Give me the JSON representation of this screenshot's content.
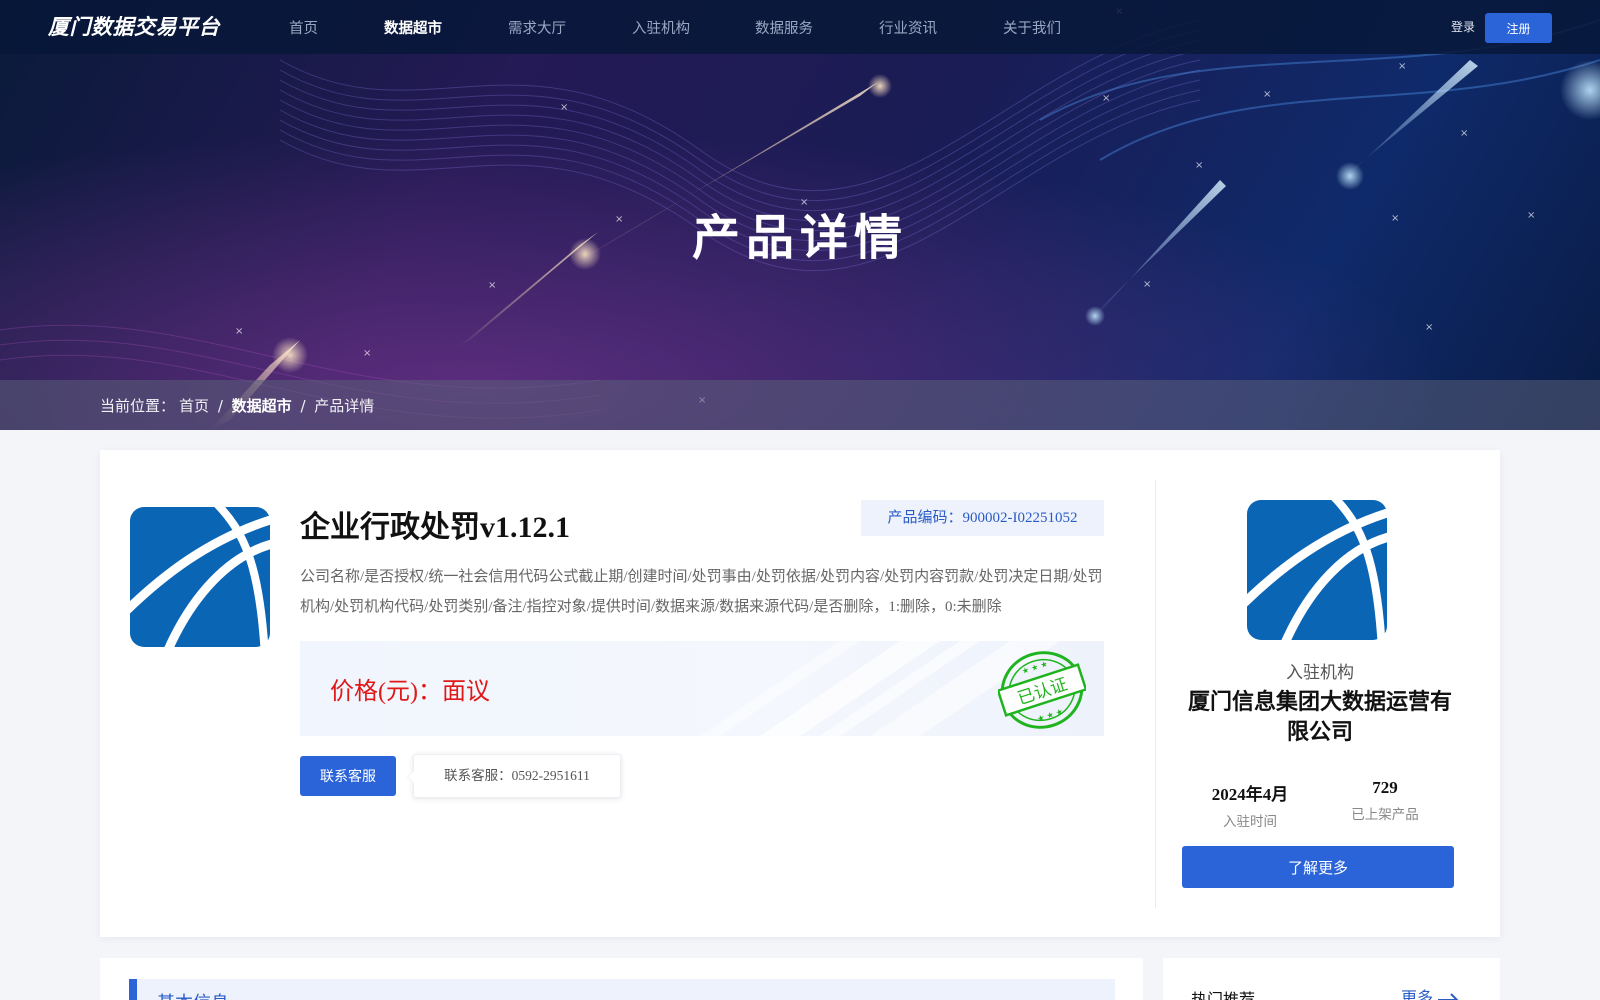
{
  "brand": {
    "name": "厦门数据交易平台"
  },
  "nav": {
    "items": [
      "首页",
      "数据超市",
      "需求大厅",
      "入驻机构",
      "数据服务",
      "行业资讯",
      "关于我们"
    ],
    "active_index": 1
  },
  "auth": {
    "login": "登录",
    "register": "注册"
  },
  "hero": {
    "title": "产品详情"
  },
  "breadcrumb": {
    "prefix": "当前位置：",
    "items": [
      "首页",
      "数据超市",
      "产品详情"
    ],
    "separator": "/"
  },
  "product": {
    "title": "企业行政处罚v1.12.1",
    "code_label": "产品编码：",
    "code": "900002-I02251052",
    "description": "公司名称/是否授权/统一社会信用代码公式截止期/创建时间/处罚事由/处罚依据/处罚内容/处罚内容罚款/处罚决定日期/处罚机构/处罚机构代码/处罚类别/备注/指控对象/提供时间/数据来源/数据来源代码/是否删除，1:删除，0:未删除",
    "price_label": "价格(元)：",
    "price_value": "面议",
    "certified_stamp": "已认证",
    "contact_button": "联系客服",
    "contact_tooltip": "联系客服：0592-2951611"
  },
  "organization": {
    "section_label": "入驻机构",
    "name": "厦门信息集团大数据运营有限公司",
    "join_date": "2024年4月",
    "join_date_label": "入驻时间",
    "product_count": "729",
    "product_count_label": "已上架产品",
    "learn_more_button": "了解更多"
  },
  "sections": {
    "basic_info_title": "基本信息",
    "hot_title": "热门推荐",
    "more_link": "更多"
  },
  "colors": {
    "primary": "#2b64d9",
    "price_red": "#e01818",
    "stamp_green": "#1fb41f",
    "logo_blue": "#0b65b5"
  },
  "icons": [
    "company-logo",
    "certified-stamp",
    "arrow-right-icon"
  ]
}
